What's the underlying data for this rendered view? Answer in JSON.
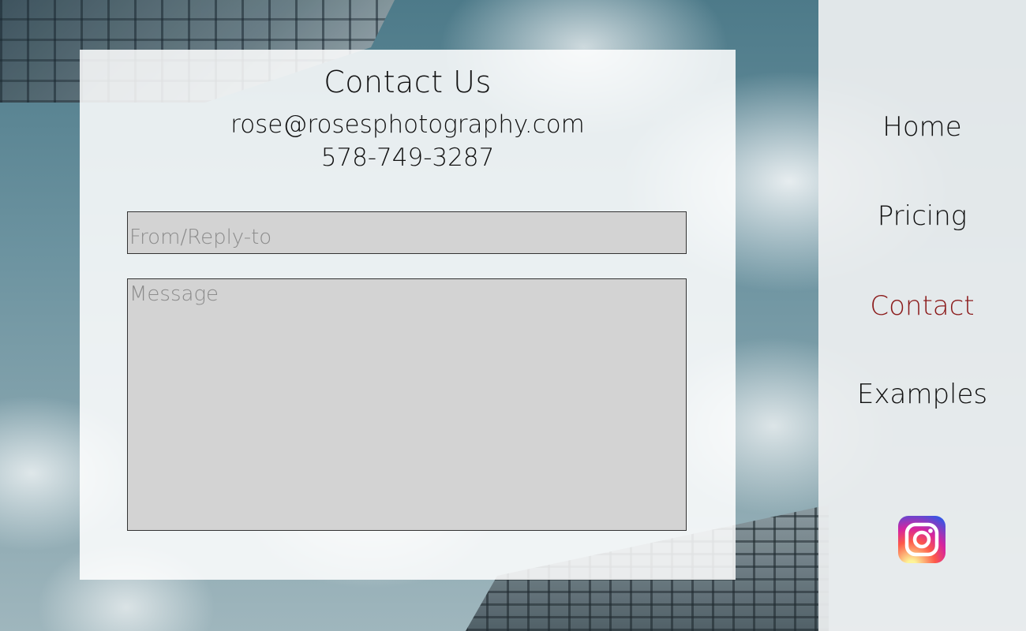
{
  "contact": {
    "title": "Contact Us",
    "email": "rose@rosesphotography.com",
    "phone": "578-749-3287",
    "from_placeholder": "From/Reply-to",
    "from_value": "",
    "message_placeholder": "Message",
    "message_value": ""
  },
  "nav": {
    "items": [
      {
        "label": "Home",
        "active": false
      },
      {
        "label": "Pricing",
        "active": false
      },
      {
        "label": "Contact",
        "active": true
      },
      {
        "label": "Examples",
        "active": false
      }
    ],
    "social_icon": "instagram-icon"
  },
  "colors": {
    "active_nav": "#8b1a1a",
    "input_bg": "#d3d3d3"
  }
}
